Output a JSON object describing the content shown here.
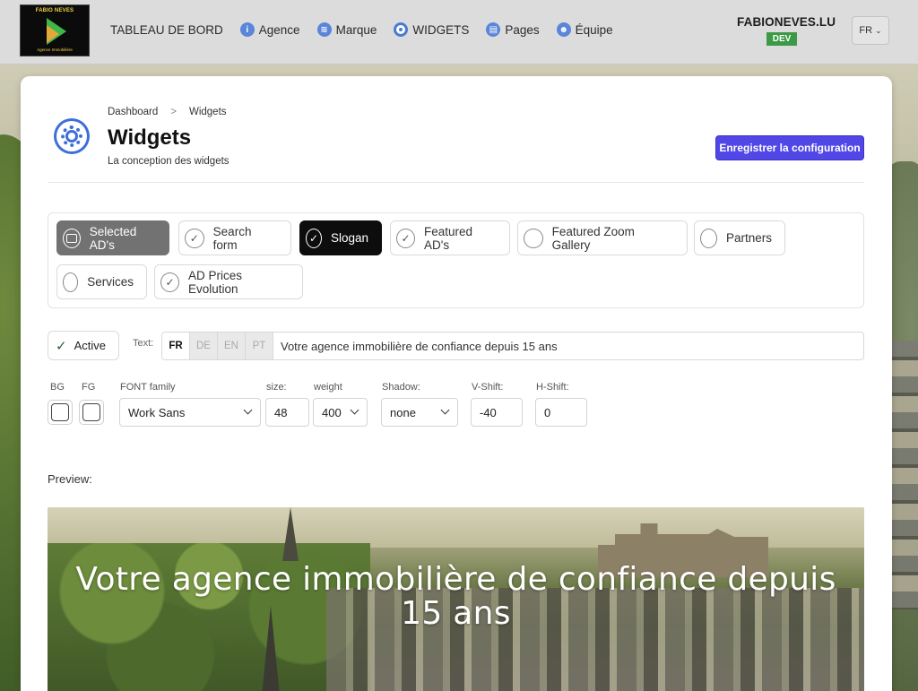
{
  "brand": {
    "logo_title": "FABIO NEVES",
    "logo_subtitle": "Agence Immobilière"
  },
  "nav": {
    "items": [
      {
        "label": "TABLEAU DE BORD",
        "icon": null
      },
      {
        "label": "Agence",
        "icon": "info-icon"
      },
      {
        "label": "Marque",
        "icon": "brand-icon"
      },
      {
        "label": "WIDGETS",
        "icon": "gear-icon"
      },
      {
        "label": "Pages",
        "icon": "page-icon"
      },
      {
        "label": "Équipe",
        "icon": "team-icon"
      }
    ]
  },
  "site": {
    "name": "FABIONEVES.LU",
    "env_badge": "DEV",
    "language": "FR"
  },
  "breadcrumb": {
    "root": "Dashboard",
    "separator": ">",
    "current": "Widgets"
  },
  "page": {
    "title": "Widgets",
    "subtitle": "La conception des widgets",
    "save_label": "Enregistrer la configuration"
  },
  "widgets": [
    {
      "label": "Selected AD's",
      "state": "selected"
    },
    {
      "label": "Search form",
      "state": "checked"
    },
    {
      "label": "Slogan",
      "state": "active-dark"
    },
    {
      "label": "Featured AD's",
      "state": "checked"
    },
    {
      "label": "Featured Zoom Gallery",
      "state": "unchecked"
    },
    {
      "label": "Partners",
      "state": "unchecked"
    },
    {
      "label": "Services",
      "state": "unchecked"
    },
    {
      "label": "AD Prices Evolution",
      "state": "checked"
    }
  ],
  "editor": {
    "active_label": "Active",
    "text_label": "Text:",
    "languages": [
      "FR",
      "DE",
      "EN",
      "PT"
    ],
    "selected_language": "FR",
    "text_value": "Votre agence immobilière de confiance depuis 15 ans",
    "labels": {
      "bg": "BG",
      "fg": "FG",
      "font_family": "FONT family",
      "size": "size:",
      "weight": "weight",
      "shadow": "Shadow:",
      "vshift": "V-Shift:",
      "hshift": "H-Shift:"
    },
    "values": {
      "font_family": "Work Sans",
      "size": "48",
      "weight": "400",
      "shadow": "none",
      "vshift": "-40",
      "hshift": "0"
    }
  },
  "preview": {
    "label": "Preview:",
    "slogan": "Votre agence immobilière de confiance depuis 15 ans"
  },
  "colors": {
    "accent": "#5146e6",
    "dev_badge": "#3c9a46",
    "icon_blue": "#3e6fd8"
  }
}
